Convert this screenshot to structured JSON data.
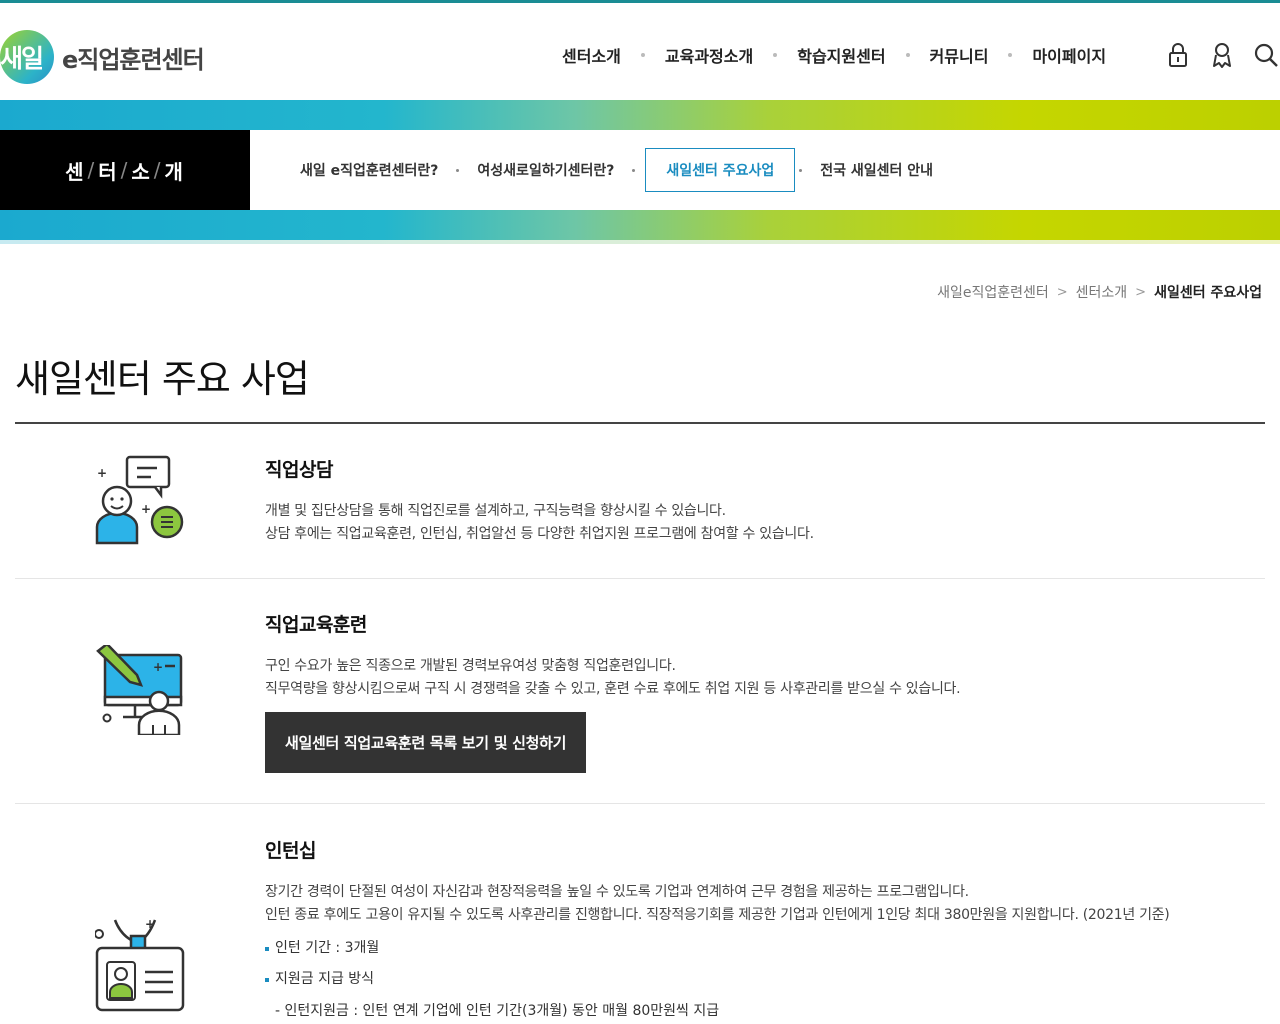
{
  "header": {
    "logo_mark": "새일",
    "logo_text": "e직업훈련센터",
    "nav": [
      "센터소개",
      "교육과정소개",
      "학습지원센터",
      "커뮤니티",
      "마이페이지"
    ],
    "tools": [
      "lock-icon",
      "user-icon",
      "search-icon"
    ]
  },
  "lnb": {
    "title_parts": [
      "센",
      "터",
      "소",
      "개"
    ],
    "items": [
      "새일 e직업훈련센터란?",
      "여성새로일하기센터란?",
      "새일센터 주요사업",
      "전국 새일센터 안내"
    ],
    "active_index": 2
  },
  "breadcrumb": [
    "새일e직업훈련센터",
    "센터소개",
    "새일센터 주요사업"
  ],
  "page_title": "새일센터 주요 사업",
  "sections": [
    {
      "title": "직업상담",
      "lines": [
        "개별 및 집단상담을 통해 직업진로를 설계하고, 구직능력을 향상시킬 수 있습니다.",
        "상담 후에는 직업교육훈련, 인턴십, 취업알선 등 다양한 취업지원 프로그램에 참여할 수 있습니다."
      ]
    },
    {
      "title": "직업교육훈련",
      "lines": [
        "구인 수요가 높은 직종으로 개발된 경력보유여성 맞춤형 직업훈련입니다.",
        "직무역량을 향상시킴으로써 구직 시 경쟁력을 갖출 수 있고, 훈련 수료 후에도 취업 지원 등 사후관리를 받으실 수 있습니다."
      ],
      "button": "새일센터 직업교육훈련 목록 보기 및 신청하기"
    },
    {
      "title": "인턴십",
      "lines": [
        "장기간 경력이 단절된 여성이 자신감과 현장적응력을 높일 수 있도록 기업과 연계하여 근무 경험을 제공하는 프로그램입니다.",
        "인턴 종료 후에도 고용이 유지될 수 있도록 사후관리를 진행합니다. 직장적응기회를 제공한 기업과 인턴에게 1인당 최대 380만원을 지원합니다. (2021년 기준)"
      ],
      "bullets": [
        "인턴 기간 : 3개월",
        "지원금 지급 방식"
      ],
      "sub": "- 인턴지원금 : 인턴 연계 기업에 인턴 기간(3개월) 동안 매월 80만원씩 지급"
    }
  ],
  "colors": {
    "accent": "#1a8cc0",
    "band_start": "#1ba9cf",
    "band_end": "#c5d600",
    "icon_blue": "#2cb3e8",
    "icon_green": "#8cc63f"
  }
}
